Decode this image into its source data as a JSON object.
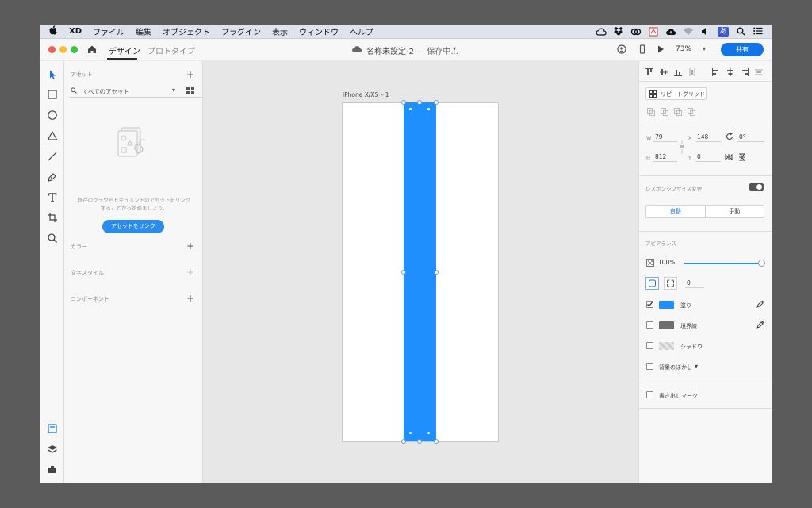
{
  "menubar": {
    "app": "XD",
    "items": [
      "ファイル",
      "編集",
      "オブジェクト",
      "プラグイン",
      "表示",
      "ウィンドウ",
      "ヘルプ"
    ],
    "ime": "あ"
  },
  "titlebar": {
    "tab_design": "デザイン",
    "tab_prototype": "プロトタイプ",
    "doc_name": "名称未設定-2",
    "doc_status": " — 保存中...",
    "zoom": "73%",
    "share": "共有"
  },
  "assets": {
    "header": "アセット",
    "search_label": "すべてのアセット",
    "description": "既存のクラウドドキュメントのアセットをリンクすることから始めましょう。",
    "link_button": "アセットをリンク",
    "colors": "カラー",
    "text_styles": "文字スタイル",
    "components": "コンポーネント"
  },
  "canvas": {
    "artboard_name": "iPhone X/XS – 1",
    "selection_color": "#1f8ffd"
  },
  "props": {
    "repeat_grid": "リピートグリッド",
    "w_label": "W",
    "w": "79",
    "x_label": "X",
    "x": "148",
    "rotation": "0°",
    "h_label": "H",
    "h": "812",
    "y_label": "Y",
    "y": "0",
    "responsive": "レスポンシブサイズ変更",
    "auto": "自動",
    "manual": "手動",
    "appearance": "アピアランス",
    "opacity": "100%",
    "opacity_value": 1.0,
    "corner_radius": "0",
    "fill": "塗り",
    "fill_checked": true,
    "fill_color": "#1f8ffd",
    "border": "境界線",
    "border_checked": false,
    "border_color": "#6e6e6e",
    "shadow": "シャドウ",
    "bg_blur": "背景のぼかし",
    "export_mark": "書き出しマーク"
  }
}
